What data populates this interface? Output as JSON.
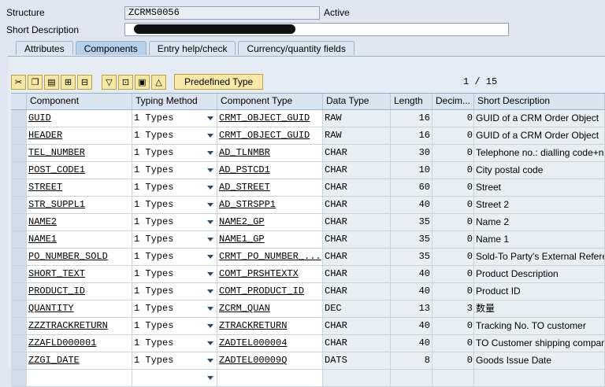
{
  "header": {
    "structure_label": "Structure",
    "structure_value": "ZCRMS0056",
    "structure_status": "Active",
    "short_desc_label": "Short Description",
    "short_desc_value": ""
  },
  "tabs": [
    {
      "label": "Attributes",
      "active": false
    },
    {
      "label": "Components",
      "active": true
    },
    {
      "label": "Entry help/check",
      "active": false
    },
    {
      "label": "Currency/quantity fields",
      "active": false
    }
  ],
  "toolbar": {
    "icons": [
      "cut-icon",
      "copy-icon",
      "paste-icon",
      "insert-row-icon",
      "delete-row-icon",
      "filter-icon",
      "expand-icon",
      "details-icon",
      "up-icon"
    ],
    "predefined_type_label": "Predefined Type",
    "pager": "1 / 15"
  },
  "columns": [
    "Component",
    "Typing Method",
    "Component Type",
    "Data Type",
    "Length",
    "Decim...",
    "Short Description"
  ],
  "rows": [
    {
      "component": "GUID",
      "typing": "1 Types",
      "ctype": "CRMT_OBJECT_GUID",
      "dtype": "RAW",
      "length": "16",
      "dec": "0",
      "desc": "GUID of a CRM Order Object"
    },
    {
      "component": "HEADER",
      "typing": "1 Types",
      "ctype": "CRMT_OBJECT_GUID",
      "dtype": "RAW",
      "length": "16",
      "dec": "0",
      "desc": "GUID of a CRM Order Object"
    },
    {
      "component": "TEL_NUMBER",
      "typing": "1 Types",
      "ctype": "AD_TLNMBR",
      "dtype": "CHAR",
      "length": "30",
      "dec": "0",
      "desc": "Telephone no.: dialling code+n"
    },
    {
      "component": "POST_CODE1",
      "typing": "1 Types",
      "ctype": "AD_PSTCD1",
      "dtype": "CHAR",
      "length": "10",
      "dec": "0",
      "desc": "City postal code"
    },
    {
      "component": "STREET",
      "typing": "1 Types",
      "ctype": "AD_STREET",
      "dtype": "CHAR",
      "length": "60",
      "dec": "0",
      "desc": "Street"
    },
    {
      "component": "STR_SUPPL1",
      "typing": "1 Types",
      "ctype": "AD_STRSPP1",
      "dtype": "CHAR",
      "length": "40",
      "dec": "0",
      "desc": "Street 2"
    },
    {
      "component": "NAME2",
      "typing": "1 Types",
      "ctype": "NAME2_GP",
      "dtype": "CHAR",
      "length": "35",
      "dec": "0",
      "desc": "Name 2"
    },
    {
      "component": "NAME1",
      "typing": "1 Types",
      "ctype": "NAME1_GP",
      "dtype": "CHAR",
      "length": "35",
      "dec": "0",
      "desc": "Name 1"
    },
    {
      "component": "PO_NUMBER_SOLD",
      "typing": "1 Types",
      "ctype": "CRMT_PO_NUMBER_...",
      "dtype": "CHAR",
      "length": "35",
      "dec": "0",
      "desc": "Sold-To Party's External Refere"
    },
    {
      "component": "SHORT_TEXT",
      "typing": "1 Types",
      "ctype": "COMT_PRSHTEXTX",
      "dtype": "CHAR",
      "length": "40",
      "dec": "0",
      "desc": "Product Description"
    },
    {
      "component": "PRODUCT_ID",
      "typing": "1 Types",
      "ctype": "COMT_PRODUCT_ID",
      "dtype": "CHAR",
      "length": "40",
      "dec": "0",
      "desc": "Product ID"
    },
    {
      "component": "QUANTITY",
      "typing": "1 Types",
      "ctype": "ZCRM_QUAN",
      "dtype": "DEC",
      "length": "13",
      "dec": "3",
      "desc": "数量"
    },
    {
      "component": "ZZZTRACKRETURN",
      "typing": "1 Types",
      "ctype": "ZTRACKRETURN",
      "dtype": "CHAR",
      "length": "40",
      "dec": "0",
      "desc": "Tracking No. TO customer"
    },
    {
      "component": "ZZAFLD000001",
      "typing": "1 Types",
      "ctype": "ZADTEL000004",
      "dtype": "CHAR",
      "length": "40",
      "dec": "0",
      "desc": "TO Customer shipping compan"
    },
    {
      "component": "ZZGI_DATE",
      "typing": "1 Types",
      "ctype": "ZADTEL00009Q",
      "dtype": "DATS",
      "length": "8",
      "dec": "0",
      "desc": "Goods Issue Date"
    },
    {
      "component": "",
      "typing": "",
      "ctype": "",
      "dtype": "",
      "length": "",
      "dec": "",
      "desc": ""
    }
  ]
}
